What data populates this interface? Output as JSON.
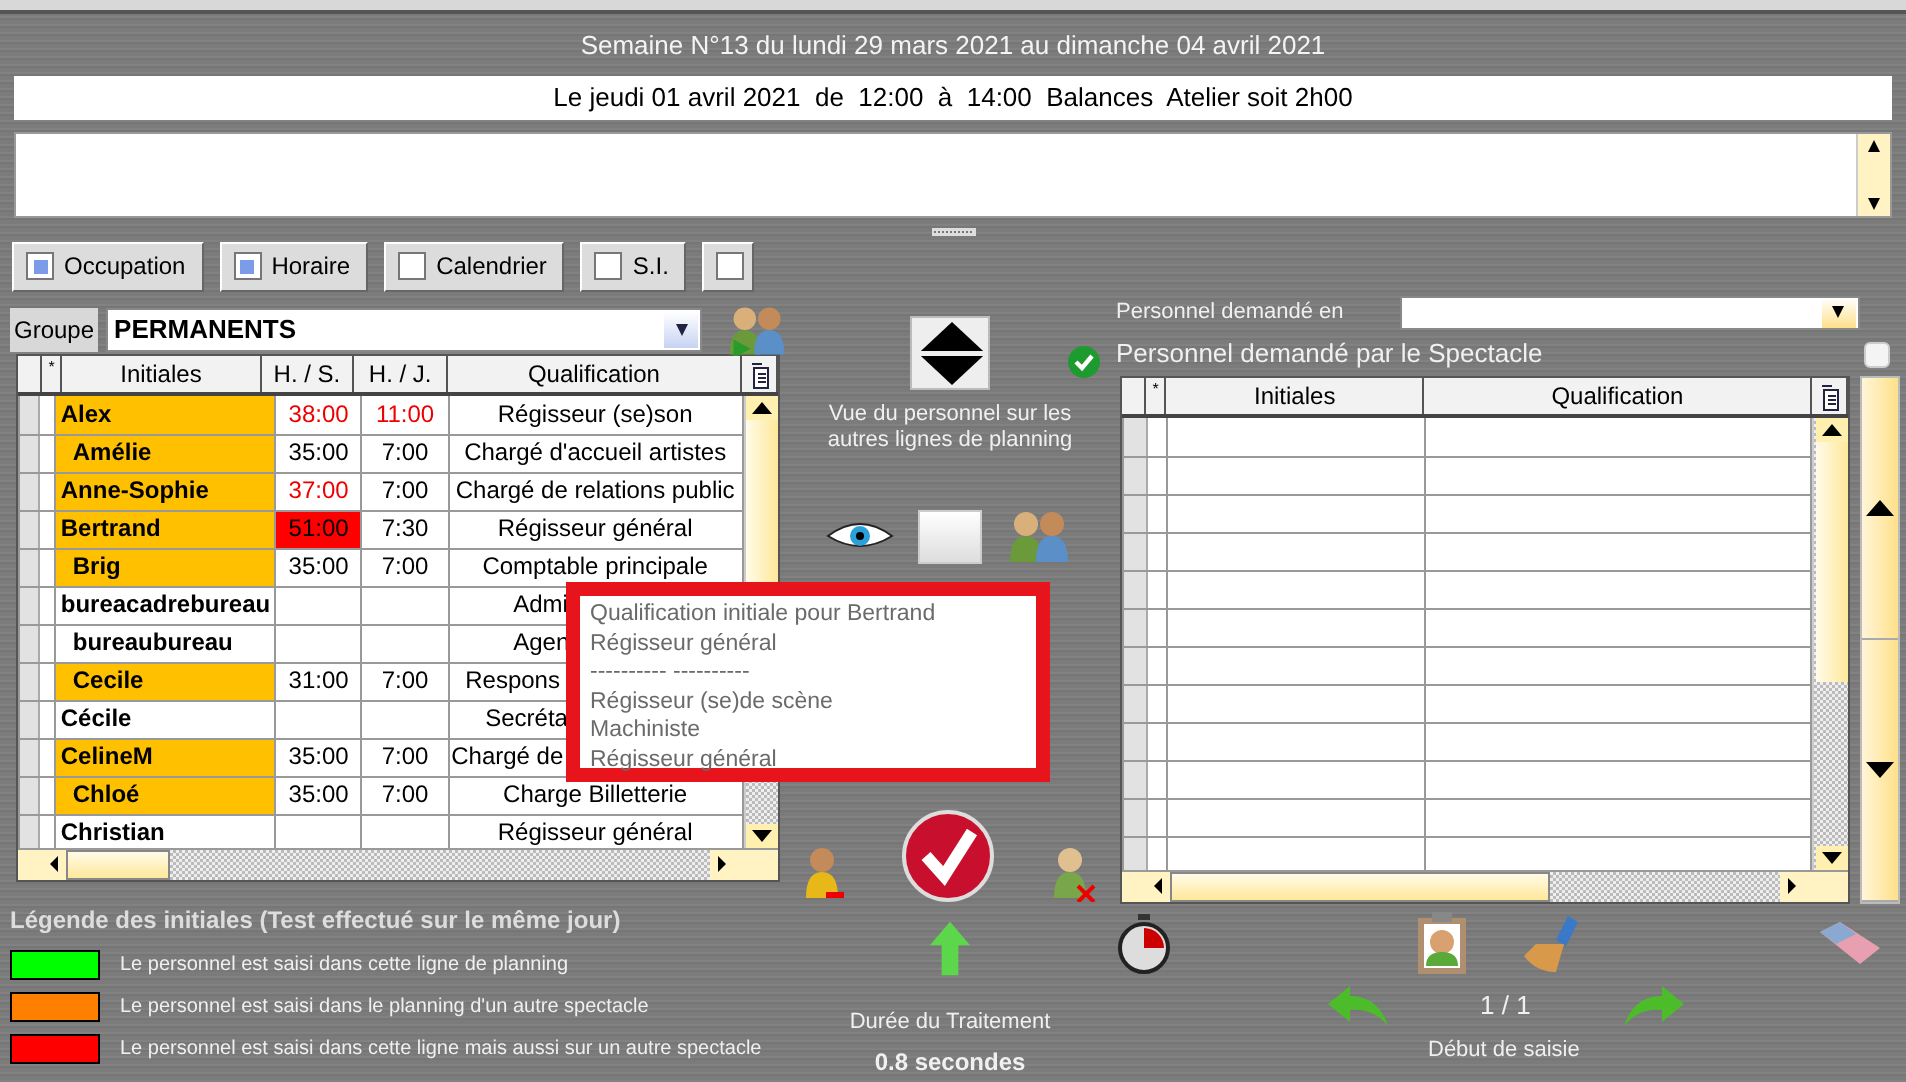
{
  "header": {
    "week": "Semaine N°13 du lundi 29 mars 2021 au dimanche 04 avril 2021",
    "session": "Le jeudi 01 avril 2021  de  12:00  à  14:00  Balances  Atelier soit 2h00"
  },
  "filters": [
    {
      "label": "Occupation",
      "checked": true
    },
    {
      "label": "Horaire",
      "checked": true
    },
    {
      "label": "Calendrier",
      "checked": false
    },
    {
      "label": "S.I.",
      "checked": false
    },
    {
      "checked": false
    }
  ],
  "group": {
    "label": "Groupe",
    "value": "PERMANENTS"
  },
  "staff_table": {
    "columns": [
      "*",
      "Initiales",
      "H. / S.",
      "H. / J.",
      "Qualification"
    ],
    "rows": [
      {
        "initials": "Alex",
        "color": "#ffc000",
        "hs": "38:00",
        "hs_over": true,
        "hs_alert": false,
        "hj": "11:00",
        "hj_over": true,
        "qualification": "Régisseur (se)son"
      },
      {
        "initials": "Amélie",
        "color": "#ffc000",
        "hs": "35:00",
        "hs_over": false,
        "hs_alert": false,
        "hj": "7:00",
        "hj_over": false,
        "qualification": "Chargé d'accueil artistes"
      },
      {
        "initials": "Anne-Sophie",
        "color": "#ffc000",
        "hs": "37:00",
        "hs_over": true,
        "hs_alert": false,
        "hj": "7:00",
        "hj_over": false,
        "qualification": "Chargé de relations public"
      },
      {
        "initials": "Bertrand",
        "color": "#ffc000",
        "hs": "51:00",
        "hs_over": false,
        "hs_alert": true,
        "hj": "7:30",
        "hj_over": false,
        "qualification": "Régisseur général"
      },
      {
        "initials": "Brig",
        "color": "#ffc000",
        "hs": "35:00",
        "hs_over": false,
        "hs_alert": false,
        "hj": "7:00",
        "hj_over": false,
        "qualification": "Comptable principale"
      },
      {
        "initials": "bureacadrebureau",
        "color": "#ffffff",
        "qualification": "Admi"
      },
      {
        "initials": "bureaubureau",
        "color": "#ffffff",
        "qualification": "Agen"
      },
      {
        "initials": "Cecile",
        "color": "#ffc000",
        "hs": "31:00",
        "hs_over": false,
        "hs_alert": false,
        "hj": "7:00",
        "hj_over": false,
        "qualification": "Respons"
      },
      {
        "initials": "Cécile",
        "color": "#ffffff",
        "qualification": "Secréta"
      },
      {
        "initials": "CelineM",
        "color": "#ffc000",
        "hs": "35:00",
        "hs_over": false,
        "hs_alert": false,
        "hj": "7:00",
        "hj_over": false,
        "qualification": "Chargé de"
      },
      {
        "initials": "Chloé",
        "color": "#ffc000",
        "hs": "35:00",
        "hs_over": false,
        "hs_alert": false,
        "hj": "7:00",
        "hj_over": false,
        "qualification": "Charge Billetterie"
      },
      {
        "initials": "Christian",
        "color": "#ffffff",
        "qualification": "Régisseur général"
      }
    ]
  },
  "view_caption": "Vue du personnel sur les autres lignes de planning",
  "tooltip": {
    "lines": [
      "Qualification initiale pour Bertrand",
      "Régisseur général",
      "---------- ----------",
      "Régisseur (se)de scène",
      "Machiniste",
      "Régisseur général"
    ]
  },
  "requested": {
    "label": "Personnel demandé en",
    "title": "Personnel demandé par le Spectacle",
    "checked": false,
    "columns": [
      "*",
      "Initiales",
      "Qualification"
    ]
  },
  "legend": {
    "title": "Légende des initiales (Test effectué sur le même jour)",
    "items": [
      {
        "color": "#00ff00",
        "text": "Le personnel est saisi dans cette ligne de planning"
      },
      {
        "color": "#ff8000",
        "text": "Le personnel est saisi  dans le planning d'un autre spectacle"
      },
      {
        "color": "#ff0000",
        "text": "Le personnel est saisi dans cette ligne mais aussi sur un autre spectacle"
      }
    ]
  },
  "processing": {
    "label": "Durée du Traitement",
    "value": "0.8 secondes"
  },
  "pager": {
    "count": "1 / 1",
    "caption": "Début de saisie"
  }
}
